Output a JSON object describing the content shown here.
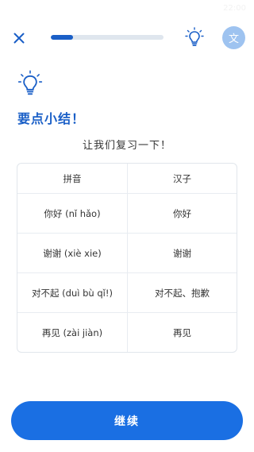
{
  "status_bar": {
    "time": "22:00"
  },
  "header": {
    "progress": 0.2,
    "lang_label": "文"
  },
  "summary": {
    "title": "要点小结！",
    "subtitle": "让我们复习一下！"
  },
  "table": {
    "headers": [
      "拼音",
      "汉子"
    ],
    "rows": [
      {
        "pinyin": "你好 (nǐ hǎo)",
        "hanzi": "你好"
      },
      {
        "pinyin": "谢谢 (xiè xie)",
        "hanzi": "谢谢"
      },
      {
        "pinyin": "对不起 (duì bù qǐ!)",
        "hanzi": "对不起、抱歉"
      },
      {
        "pinyin": "再见 (zài jiàn)",
        "hanzi": "再见"
      }
    ]
  },
  "footer": {
    "continue_label": "继续"
  },
  "colors": {
    "accent": "#1a6fe3",
    "title": "#1a5fc7",
    "lang_badge": "#9ec3f0",
    "track": "#dfe6ee"
  },
  "icons": {
    "close": "close-icon",
    "hint": "lightbulb-icon",
    "lang": "translate-icon"
  }
}
